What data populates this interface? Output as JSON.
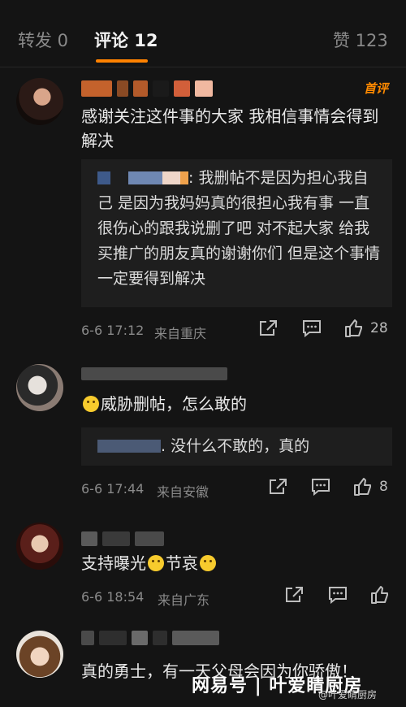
{
  "tabs": {
    "repost": "转发 0",
    "comments": "评论 12",
    "likes": "赞 123"
  },
  "accent_color": "#ff8200",
  "comments": [
    {
      "hot_badge": "首评",
      "text": "感谢关注这件事的大家 我相信事情会得到解决",
      "reply": ": 我删帖不是因为担心我自己 是因为我妈妈真的很担心我有事 一直很伤心的跟我说删了吧 对不起大家 给我买推广的朋友真的谢谢你们 但是这个事情一定要得到解决",
      "time": "6-6 17:12",
      "location": "来自重庆",
      "likes": "28"
    },
    {
      "text": "威胁删帖，怎么敢的",
      "reply": ". 没什么不敢的，真的",
      "time": "6-6 17:44",
      "location": "来自安徽",
      "likes": "8"
    },
    {
      "text_a": "支持曝光",
      "text_b": "节哀",
      "time": "6-6 18:54",
      "location": "来自广东"
    },
    {
      "text": "真的勇士，有一天父母会因为你骄傲！"
    }
  ],
  "watermark": {
    "main": "网易号 | 叶爱睛厨房",
    "small": "@叶爱睛厨房"
  }
}
